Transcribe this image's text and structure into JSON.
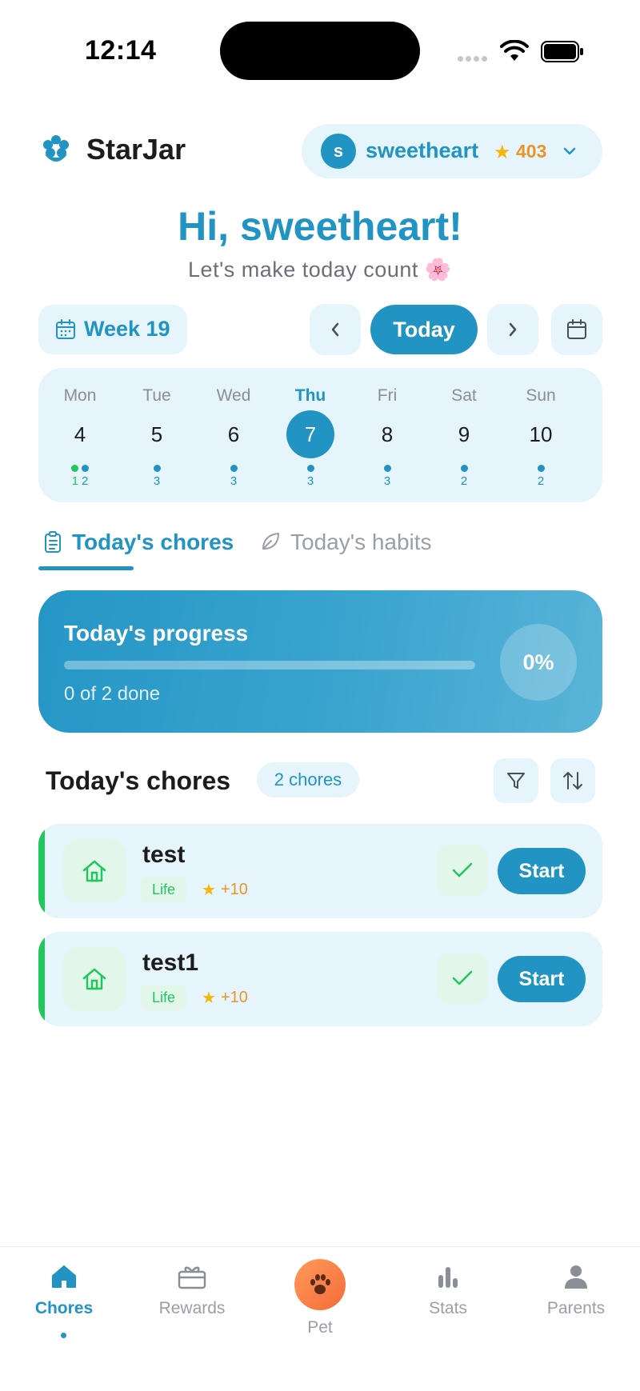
{
  "status_bar": {
    "time": "12:14"
  },
  "header": {
    "app_name": "StarJar",
    "profile": {
      "initial": "s",
      "name": "sweetheart",
      "points": "403"
    }
  },
  "greeting": {
    "title": "Hi, sweetheart!",
    "subtitle": "Let's make today count 🌸"
  },
  "week_nav": {
    "week_label": "Week 19",
    "today_label": "Today"
  },
  "calendar": {
    "days": [
      {
        "name": "Mon",
        "num": "4",
        "counts": [
          {
            "value": "1",
            "color": "green"
          },
          {
            "value": "2",
            "color": "blue"
          }
        ]
      },
      {
        "name": "Tue",
        "num": "5",
        "counts": [
          {
            "value": "3",
            "color": "blue"
          }
        ]
      },
      {
        "name": "Wed",
        "num": "6",
        "counts": [
          {
            "value": "3",
            "color": "blue"
          }
        ]
      },
      {
        "name": "Thu",
        "num": "7",
        "counts": [
          {
            "value": "3",
            "color": "blue"
          }
        ],
        "active": true
      },
      {
        "name": "Fri",
        "num": "8",
        "counts": [
          {
            "value": "3",
            "color": "blue"
          }
        ]
      },
      {
        "name": "Sat",
        "num": "9",
        "counts": [
          {
            "value": "2",
            "color": "blue"
          }
        ]
      },
      {
        "name": "Sun",
        "num": "10",
        "counts": [
          {
            "value": "2",
            "color": "blue"
          }
        ]
      }
    ]
  },
  "tabs": {
    "chores": "Today's chores",
    "habits": "Today's habits"
  },
  "progress": {
    "title": "Today's progress",
    "subtitle": "0 of 2 done",
    "percent_label": "0%",
    "fraction": 0
  },
  "section": {
    "title": "Today's chores",
    "count_badge": "2 chores"
  },
  "chores": [
    {
      "name": "test",
      "tag": "Life",
      "points": "+10",
      "action": "Start"
    },
    {
      "name": "test1",
      "tag": "Life",
      "points": "+10",
      "action": "Start"
    }
  ],
  "bottom_nav": {
    "items": [
      {
        "label": "Chores",
        "icon": "home-icon",
        "active": true
      },
      {
        "label": "Rewards",
        "icon": "gift-icon"
      },
      {
        "label": "Pet",
        "icon": "paw-icon"
      },
      {
        "label": "Stats",
        "icon": "bar-chart-icon"
      },
      {
        "label": "Parents",
        "icon": "person-icon"
      }
    ]
  },
  "colors": {
    "primary": "#2194c4",
    "light_bg": "#e6f4fb",
    "green": "#22c55e",
    "orange": "#e8952a",
    "star": "#f5b50a"
  }
}
